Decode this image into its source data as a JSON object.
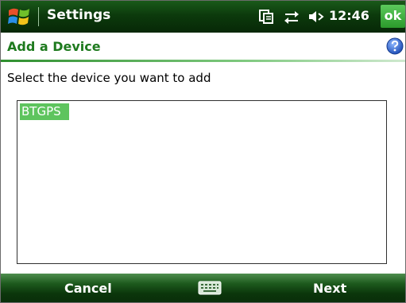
{
  "window": {
    "app_title": "Settings",
    "clock": "12:46",
    "ok_label": "ok"
  },
  "status_icons": [
    "sync-icon",
    "connectivity-icon",
    "volume-icon"
  ],
  "header": {
    "title": "Add a Device",
    "help_icon": "help-icon"
  },
  "body": {
    "instruction": "Select the device you want to add",
    "devices": [
      {
        "label": "BTGPS",
        "selected": true
      }
    ]
  },
  "softkeys": {
    "left_label": "Cancel",
    "right_label": "Next",
    "center_icon": "keyboard-icon"
  },
  "colors": {
    "title_bar": "#0c3a0c",
    "accent_green": "#1e7a1e",
    "selection": "#5ec45e",
    "ok_button": "#2b9a2b"
  }
}
